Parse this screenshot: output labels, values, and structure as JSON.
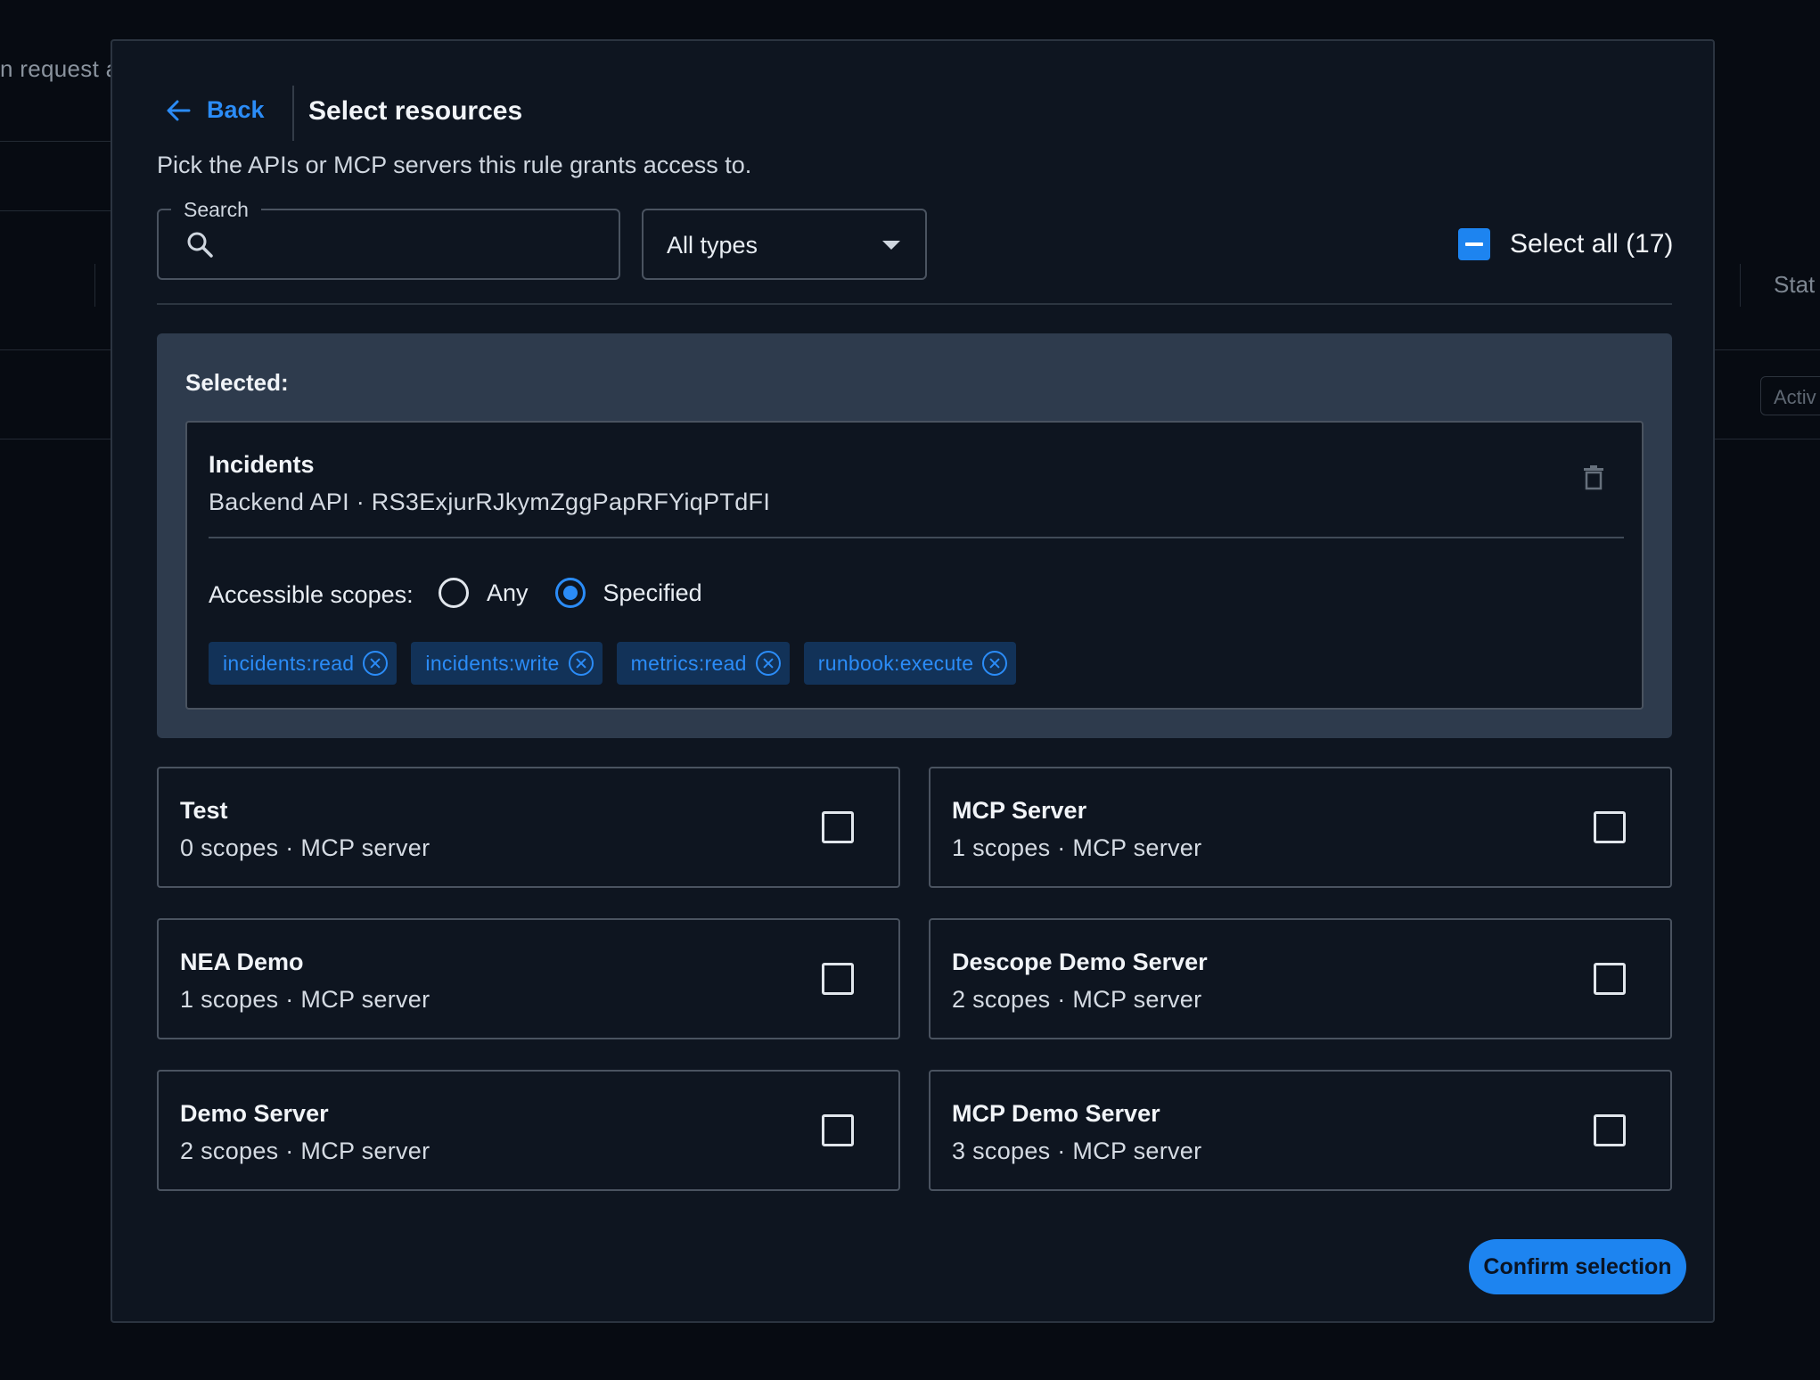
{
  "background": {
    "left_text": "n request a",
    "right_header": "Stat",
    "right_badge": "Activ"
  },
  "modal": {
    "back_label": "Back",
    "title": "Select resources",
    "subtitle": "Pick the APIs or MCP servers this rule grants access to.",
    "search": {
      "legend": "Search",
      "value": "",
      "placeholder": ""
    },
    "type_filter": {
      "selected": "All types"
    },
    "select_all": {
      "label": "Select all (17)",
      "state": "indeterminate"
    },
    "selected_panel": {
      "title": "Selected:",
      "item": {
        "name": "Incidents",
        "meta": "Backend API · RS3ExjurRJkymZggPapRFYiqPTdFI",
        "scopes_label": "Accessible scopes:",
        "scope_modes": [
          {
            "label": "Any",
            "checked": false
          },
          {
            "label": "Specified",
            "checked": true
          }
        ],
        "scopes": [
          "incidents:read",
          "incidents:write",
          "metrics:read",
          "runbook:execute"
        ]
      }
    },
    "resources": [
      {
        "name": "Test",
        "meta": "0 scopes · MCP server",
        "checked": false
      },
      {
        "name": "MCP Server",
        "meta": "1 scopes · MCP server",
        "checked": false
      },
      {
        "name": "NEA Demo",
        "meta": "1 scopes · MCP server",
        "checked": false
      },
      {
        "name": "Descope Demo Server",
        "meta": "2 scopes · MCP server",
        "checked": false
      },
      {
        "name": "Demo Server",
        "meta": "2 scopes · MCP server",
        "checked": false
      },
      {
        "name": "MCP Demo Server",
        "meta": "3 scopes · MCP server",
        "checked": false
      }
    ],
    "confirm_label": "Confirm selection"
  },
  "colors": {
    "accent": "#1d84f0",
    "modal_bg": "#0e1520",
    "selected_panel_bg": "#2e3b4d",
    "chip_bg": "#123258"
  }
}
